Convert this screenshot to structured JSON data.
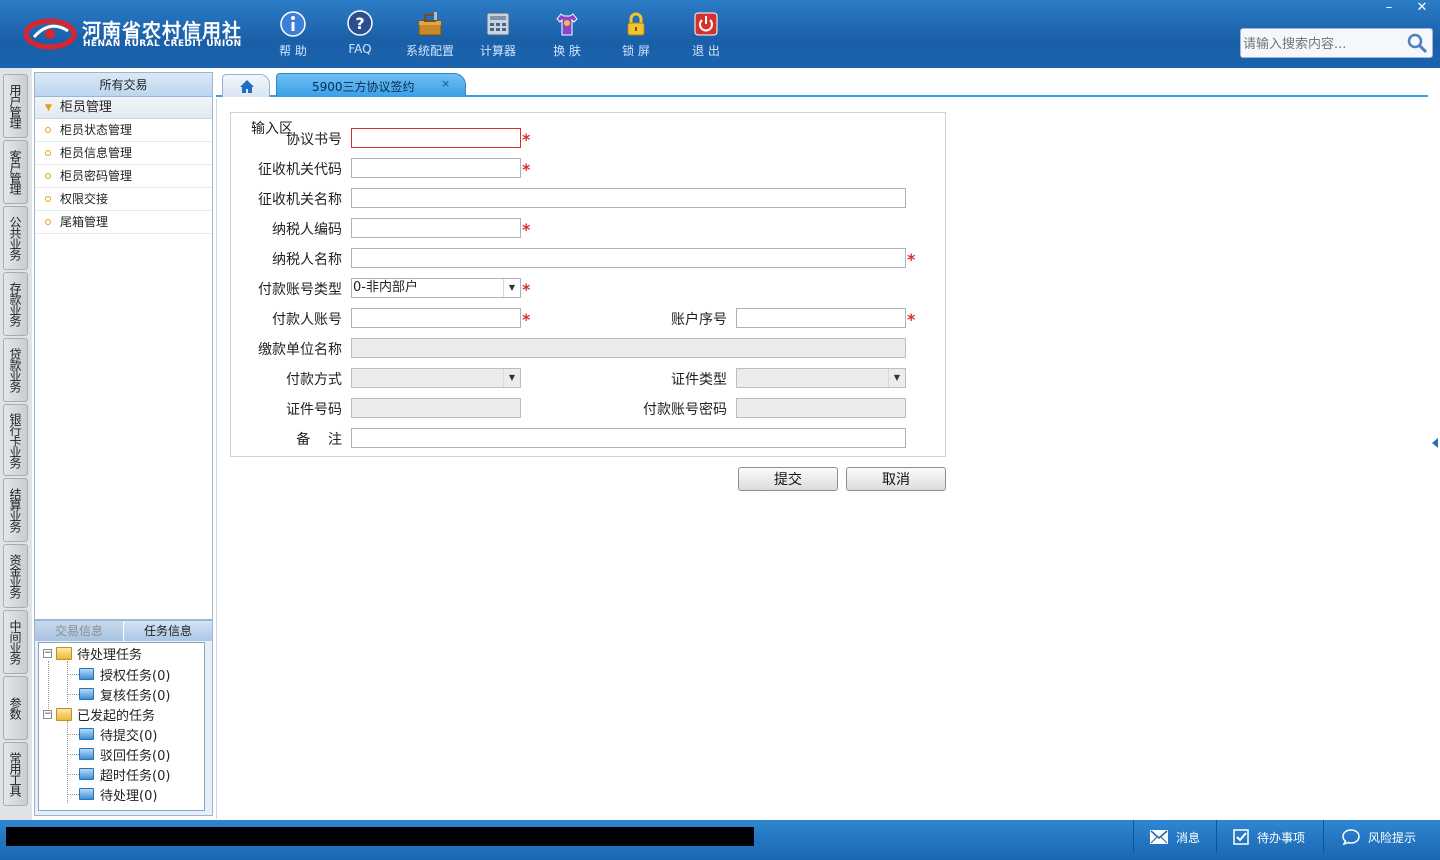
{
  "app": {
    "logo_cn": "河南省农村信用社",
    "logo_en": "HENAN RURAL CREDIT UNION"
  },
  "toolbar": [
    {
      "label": "帮 助",
      "icon": "help-icon"
    },
    {
      "label": "FAQ",
      "icon": "faq-icon"
    },
    {
      "label": "系统配置",
      "icon": "toolbox-icon"
    },
    {
      "label": "计算器",
      "icon": "calculator-icon"
    },
    {
      "label": "换 肤",
      "icon": "shirt-icon"
    },
    {
      "label": "锁 屏",
      "icon": "lock-icon"
    },
    {
      "label": "退 出",
      "icon": "power-icon"
    }
  ],
  "window_controls": {
    "minimize": "–",
    "close": "✕"
  },
  "search": {
    "placeholder": "请输入搜索内容..."
  },
  "vertical_tabs": [
    "用户管理",
    "客户管理",
    "公共业务",
    "存款业务",
    "贷款业务",
    "银行卡业务",
    "结算业务",
    "资金业务",
    "中间业务",
    "参数",
    "常用工具"
  ],
  "menu": {
    "header": "所有交易",
    "group": "柜员管理",
    "items": [
      "柜员状态管理",
      "柜员信息管理",
      "柜员密码管理",
      "权限交接",
      "尾箱管理"
    ]
  },
  "task_panel": {
    "tabs": [
      "交易信息",
      "任务信息"
    ],
    "tree": [
      {
        "label": "待处理任务",
        "children": [
          "授权任务(0)",
          "复核任务(0)"
        ]
      },
      {
        "label": "已发起的任务",
        "children": [
          "待提交(0)",
          "驳回任务(0)",
          "超时任务(0)",
          "待处理(0)"
        ]
      }
    ]
  },
  "tabs": {
    "active_label": "5900三方协议签约",
    "close": "×"
  },
  "form": {
    "legend": "输入区",
    "labels": {
      "agreement_no": "协议书号",
      "tax_office_code": "征收机关代码",
      "tax_office_name": "征收机关名称",
      "taxpayer_code": "纳税人编码",
      "taxpayer_name": "纳税人名称",
      "payer_account_type": "付款账号类型",
      "payer_account": "付款人账号",
      "account_seq": "账户序号",
      "payer_unit_name": "缴款单位名称",
      "payment_method": "付款方式",
      "id_type": "证件类型",
      "id_number": "证件号码",
      "account_password": "付款账号密码",
      "remark": "备    注"
    },
    "values": {
      "agreement_no": "",
      "tax_office_code": "",
      "tax_office_name": "",
      "taxpayer_code": "",
      "taxpayer_name": "",
      "payer_account_type": "0-非内部户",
      "payer_account": "",
      "account_seq": "",
      "payer_unit_name": "",
      "payment_method": "",
      "id_type": "",
      "id_number": "",
      "account_password": "",
      "remark": ""
    },
    "required_mark": "*",
    "submit": "提交",
    "cancel": "取消"
  },
  "statusbar": {
    "message": "",
    "items": [
      {
        "label": "消息",
        "icon": "mail-icon"
      },
      {
        "label": "待办事项",
        "icon": "checkbox-icon"
      },
      {
        "label": "风险提示",
        "icon": "chat-bubble-icon"
      }
    ]
  },
  "colors": {
    "header_blue": "#1b63ad",
    "tab_active": "#3a9ee6",
    "required_red": "#d9302c",
    "menu_accent": "#e8a000"
  }
}
